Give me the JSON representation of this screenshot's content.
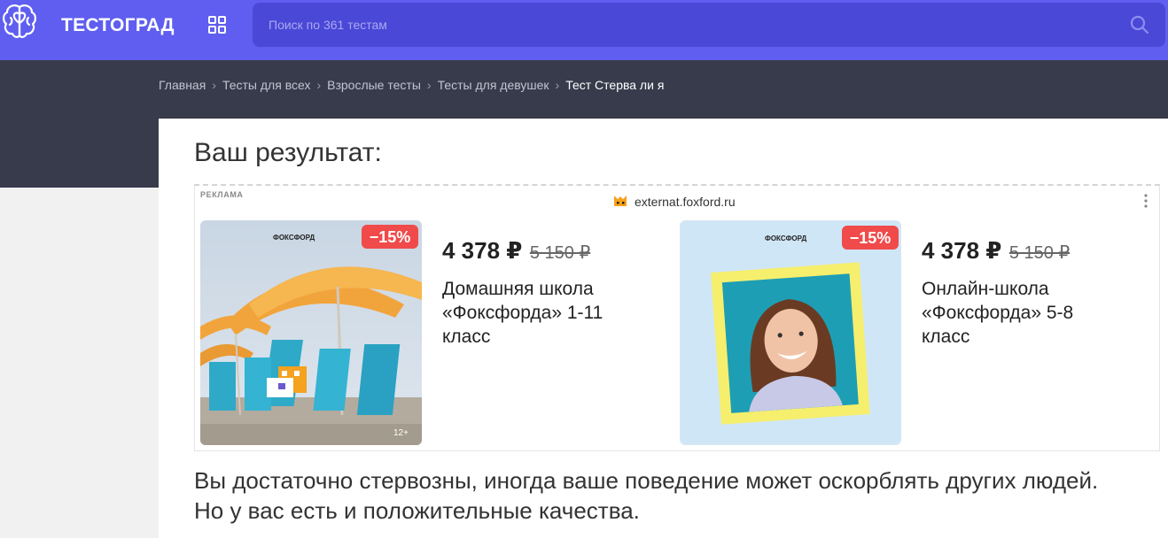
{
  "header": {
    "logo": "ТЕСТОГРАД",
    "search_placeholder": "Поиск по 361 тестам"
  },
  "breadcrumb": {
    "items": [
      "Главная",
      "Тесты для всех",
      "Взрослые тесты",
      "Тесты для девушек"
    ],
    "current": "Тест Стерва ли я"
  },
  "result": {
    "title": "Ваш результат:",
    "description": "Вы достаточно стервозны, иногда ваше поведение может оскорблять других людей. Но у вас есть и положительные качества."
  },
  "ad": {
    "label": "РЕКЛАМА",
    "domain": "externat.foxford.ru",
    "products": [
      {
        "brand": "ФОКСФОРД",
        "discount": "−15%",
        "age": "12+",
        "price": "4 378 ₽",
        "old_price": "5 150 ₽",
        "name": "Домашняя школа «Фоксфорда» 1-11 класс"
      },
      {
        "brand": "ФОКСФОРД",
        "discount": "−15%",
        "price": "4 378 ₽",
        "old_price": "5 150 ₽",
        "name": "Онлайн-школа «Фоксфорда» 5-8 класс"
      }
    ]
  },
  "colors": {
    "header": "#5f5ef0",
    "search": "#4a48d6",
    "band": "#383b4c",
    "discount": "#f04a4a"
  }
}
